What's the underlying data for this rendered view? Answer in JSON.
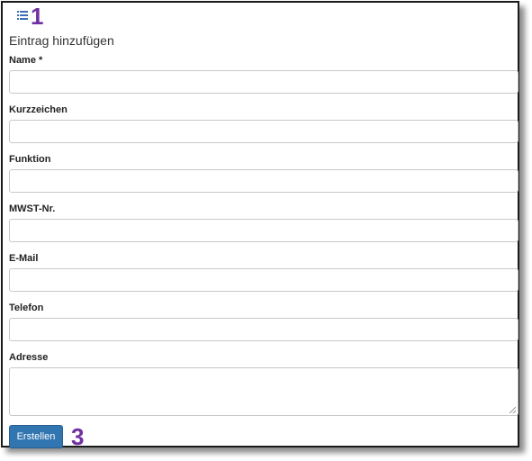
{
  "header": {
    "icon": "list-icon",
    "title": "Eintrag hinzufügen"
  },
  "annotations": [
    {
      "label": "1",
      "color": "#7030a0"
    },
    {
      "label": "3",
      "color": "#7030a0"
    }
  ],
  "form": {
    "fields": [
      {
        "label": "Name",
        "required_mark": "*",
        "value": ""
      },
      {
        "label": "Kurzzeichen",
        "value": ""
      },
      {
        "label": "Funktion",
        "value": ""
      },
      {
        "label": "MWST-Nr.",
        "value": ""
      },
      {
        "label": "E-Mail",
        "value": ""
      },
      {
        "label": "Telefon",
        "value": ""
      },
      {
        "label": "Adresse",
        "value": ""
      }
    ],
    "submit_label": "Erstellen"
  },
  "colors": {
    "button": "#3276b1",
    "icon": "#3a6fb5",
    "annotation": "#7030a0"
  }
}
